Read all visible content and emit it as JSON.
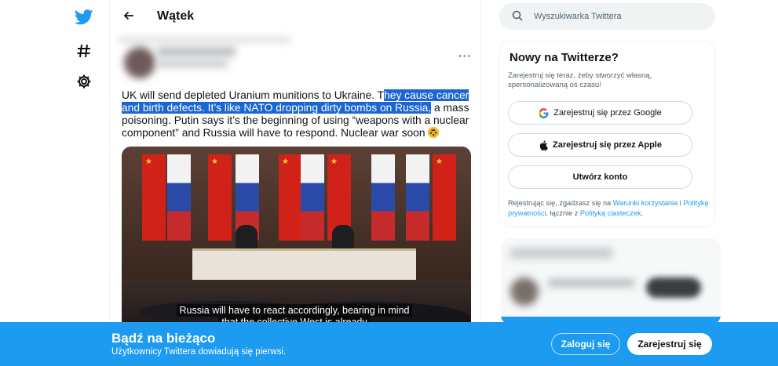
{
  "nav": {
    "icons": [
      "twitter-bird-icon",
      "hashtag-icon",
      "gear-icon"
    ]
  },
  "header": {
    "title": "Wątek"
  },
  "tweet": {
    "text_before": "UK will send depleted Uranium munitions to Ukraine. T",
    "text_highlighted": "hey cause cancer and birth defects. It’s like NATO dropping dirty bombs on Russia,",
    "text_after": " a mass poisoning. Putin says it’s the beginning of using “weapons with a nuclear component” and Russia will have to respond. Nuclear war soon ",
    "emoji_icon": "radioactive-icon",
    "media_subtitle_line1": "Russia will have to react accordingly, bearing in mind",
    "media_subtitle_line2": "that the collective West is already"
  },
  "search": {
    "placeholder": "Wyszukiwarka Twittera"
  },
  "signup": {
    "title": "Nowy na Twitterze?",
    "subtitle": "Zarejestruj się teraz, żeby stworzyć własną, spersonalizowaną oś czasu!",
    "google_label": "Zarejestruj się przez Google",
    "apple_label": "Zarejestruj się przez Apple",
    "create_label": "Utwórz konto",
    "legal_prefix": "Rejestrując się, zgadzasz się na ",
    "legal_terms": "Warunki korzystania",
    "legal_and": " i ",
    "legal_privacy": "Politykę prywatności",
    "legal_mid": ", łącznie z ",
    "legal_cookies": "Polityką ciasteczek",
    "legal_end": "."
  },
  "banner": {
    "title": "Bądź na bieżąco",
    "subtitle": "Użytkownicy Twittera dowiadują się pierwsi.",
    "login_label": "Zaloguj się",
    "register_label": "Zarejestruj się"
  },
  "colors": {
    "brand": "#1d9bf0",
    "highlight": "#1a66d2"
  }
}
